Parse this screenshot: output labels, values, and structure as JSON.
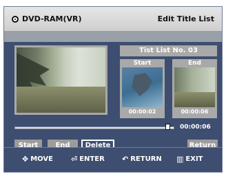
{
  "header": {
    "disc_label": "DVD-RAM(VR)",
    "screen_title": "Edit Title List"
  },
  "list": {
    "title": "Tist List No. 03"
  },
  "thumbnails": [
    {
      "label": "Start",
      "time": "00:00:02"
    },
    {
      "label": "End",
      "time": "00:00:06"
    }
  ],
  "progress": {
    "time": "00:00:06",
    "position_fraction": 0.96
  },
  "buttons": {
    "start": "Start",
    "end": "End",
    "delete": "Delete",
    "return": "Return",
    "selected": "delete"
  },
  "footer": {
    "move": "MOVE",
    "enter": "ENTER",
    "return": "RETURN",
    "exit": "EXIT"
  },
  "colors": {
    "background": "#3e4e70",
    "header": "#d8d8d8",
    "panel_gray": "#a9a9a9",
    "button_gray": "#9c9c9c"
  },
  "icons": {
    "disc": "disc-icon",
    "move": "four-way-arrow-icon",
    "enter": "enter-icon",
    "return": "return-arrow-icon",
    "exit": "menu-exit-icon"
  }
}
